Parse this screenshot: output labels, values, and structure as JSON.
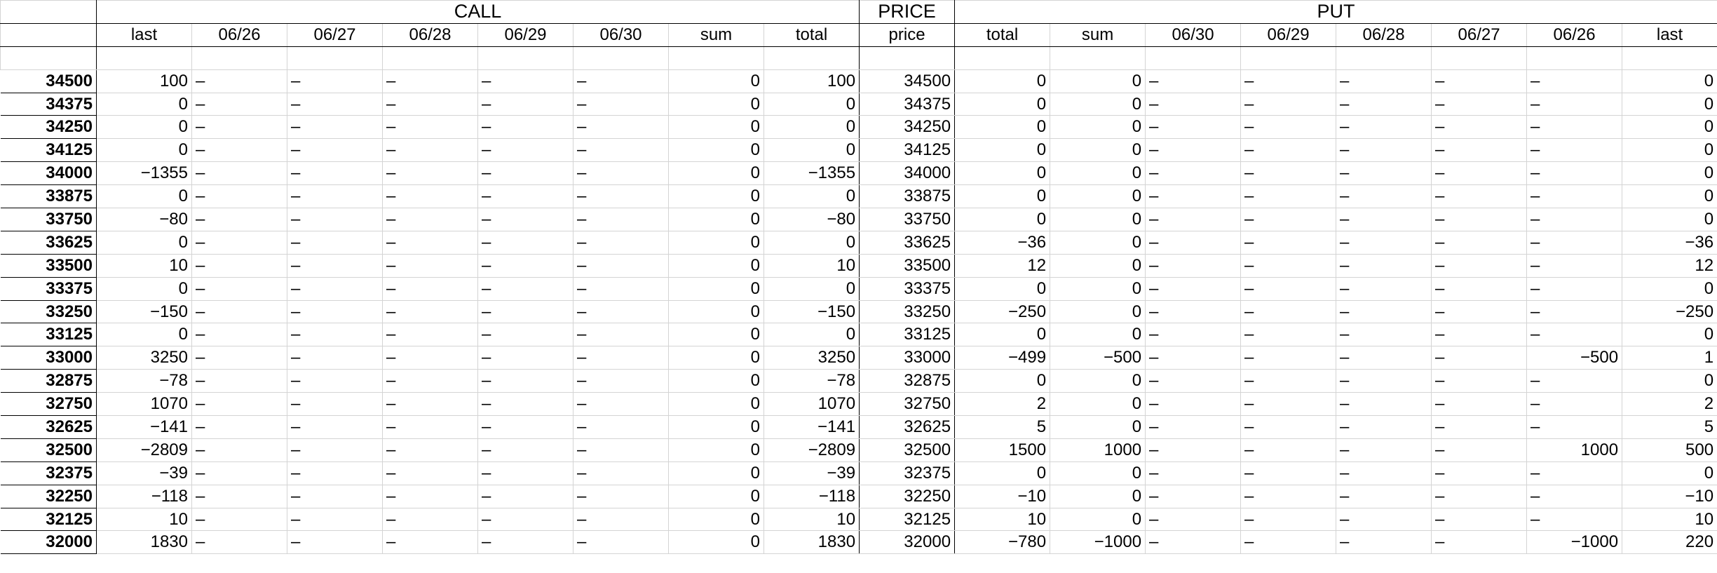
{
  "header": {
    "groups": {
      "call": "CALL",
      "price": "PRICE",
      "put": "PUT"
    },
    "columns": [
      "last",
      "06/26",
      "06/27",
      "06/28",
      "06/29",
      "06/30",
      "sum",
      "total",
      "price",
      "total",
      "sum",
      "06/30",
      "06/29",
      "06/28",
      "06/27",
      "06/26",
      "last"
    ]
  },
  "rows": [
    {
      "key": "34500",
      "call": [
        "100",
        "–",
        "–",
        "–",
        "–",
        "–",
        "0",
        "100"
      ],
      "price": "34500",
      "put": [
        "0",
        "0",
        "–",
        "–",
        "–",
        "–",
        "–",
        "0"
      ]
    },
    {
      "key": "34375",
      "call": [
        "0",
        "–",
        "–",
        "–",
        "–",
        "–",
        "0",
        "0"
      ],
      "price": "34375",
      "put": [
        "0",
        "0",
        "–",
        "–",
        "–",
        "–",
        "–",
        "0"
      ]
    },
    {
      "key": "34250",
      "call": [
        "0",
        "–",
        "–",
        "–",
        "–",
        "–",
        "0",
        "0"
      ],
      "price": "34250",
      "put": [
        "0",
        "0",
        "–",
        "–",
        "–",
        "–",
        "–",
        "0"
      ]
    },
    {
      "key": "34125",
      "call": [
        "0",
        "–",
        "–",
        "–",
        "–",
        "–",
        "0",
        "0"
      ],
      "price": "34125",
      "put": [
        "0",
        "0",
        "–",
        "–",
        "–",
        "–",
        "–",
        "0"
      ]
    },
    {
      "key": "34000",
      "call": [
        "−1355",
        "–",
        "–",
        "–",
        "–",
        "–",
        "0",
        "−1355"
      ],
      "price": "34000",
      "put": [
        "0",
        "0",
        "–",
        "–",
        "–",
        "–",
        "–",
        "0"
      ]
    },
    {
      "key": "33875",
      "call": [
        "0",
        "–",
        "–",
        "–",
        "–",
        "–",
        "0",
        "0"
      ],
      "price": "33875",
      "put": [
        "0",
        "0",
        "–",
        "–",
        "–",
        "–",
        "–",
        "0"
      ]
    },
    {
      "key": "33750",
      "call": [
        "−80",
        "–",
        "–",
        "–",
        "–",
        "–",
        "0",
        "−80"
      ],
      "price": "33750",
      "put": [
        "0",
        "0",
        "–",
        "–",
        "–",
        "–",
        "–",
        "0"
      ]
    },
    {
      "key": "33625",
      "call": [
        "0",
        "–",
        "–",
        "–",
        "–",
        "–",
        "0",
        "0"
      ],
      "price": "33625",
      "put": [
        "−36",
        "0",
        "–",
        "–",
        "–",
        "–",
        "–",
        "−36"
      ]
    },
    {
      "key": "33500",
      "call": [
        "10",
        "–",
        "–",
        "–",
        "–",
        "–",
        "0",
        "10"
      ],
      "price": "33500",
      "put": [
        "12",
        "0",
        "–",
        "–",
        "–",
        "–",
        "–",
        "12"
      ]
    },
    {
      "key": "33375",
      "call": [
        "0",
        "–",
        "–",
        "–",
        "–",
        "–",
        "0",
        "0"
      ],
      "price": "33375",
      "put": [
        "0",
        "0",
        "–",
        "–",
        "–",
        "–",
        "–",
        "0"
      ]
    },
    {
      "key": "33250",
      "call": [
        "−150",
        "–",
        "–",
        "–",
        "–",
        "–",
        "0",
        "−150"
      ],
      "price": "33250",
      "put": [
        "−250",
        "0",
        "–",
        "–",
        "–",
        "–",
        "–",
        "−250"
      ]
    },
    {
      "key": "33125",
      "call": [
        "0",
        "–",
        "–",
        "–",
        "–",
        "–",
        "0",
        "0"
      ],
      "price": "33125",
      "put": [
        "0",
        "0",
        "–",
        "–",
        "–",
        "–",
        "–",
        "0"
      ]
    },
    {
      "key": "33000",
      "call": [
        "3250",
        "–",
        "–",
        "–",
        "–",
        "–",
        "0",
        "3250"
      ],
      "price": "33000",
      "put": [
        "−499",
        "−500",
        "–",
        "–",
        "–",
        "–",
        "−500",
        "1"
      ]
    },
    {
      "key": "32875",
      "call": [
        "−78",
        "–",
        "–",
        "–",
        "–",
        "–",
        "0",
        "−78"
      ],
      "price": "32875",
      "put": [
        "0",
        "0",
        "–",
        "–",
        "–",
        "–",
        "–",
        "0"
      ]
    },
    {
      "key": "32750",
      "call": [
        "1070",
        "–",
        "–",
        "–",
        "–",
        "–",
        "0",
        "1070"
      ],
      "price": "32750",
      "put": [
        "2",
        "0",
        "–",
        "–",
        "–",
        "–",
        "–",
        "2"
      ]
    },
    {
      "key": "32625",
      "call": [
        "−141",
        "–",
        "–",
        "–",
        "–",
        "–",
        "0",
        "−141"
      ],
      "price": "32625",
      "put": [
        "5",
        "0",
        "–",
        "–",
        "–",
        "–",
        "–",
        "5"
      ]
    },
    {
      "key": "32500",
      "call": [
        "−2809",
        "–",
        "–",
        "–",
        "–",
        "–",
        "0",
        "−2809"
      ],
      "price": "32500",
      "put": [
        "1500",
        "1000",
        "–",
        "–",
        "–",
        "–",
        "1000",
        "500"
      ]
    },
    {
      "key": "32375",
      "call": [
        "−39",
        "–",
        "–",
        "–",
        "–",
        "–",
        "0",
        "−39"
      ],
      "price": "32375",
      "put": [
        "0",
        "0",
        "–",
        "–",
        "–",
        "–",
        "–",
        "0"
      ]
    },
    {
      "key": "32250",
      "call": [
        "−118",
        "–",
        "–",
        "–",
        "–",
        "–",
        "0",
        "−118"
      ],
      "price": "32250",
      "put": [
        "−10",
        "0",
        "–",
        "–",
        "–",
        "–",
        "–",
        "−10"
      ]
    },
    {
      "key": "32125",
      "call": [
        "10",
        "–",
        "–",
        "–",
        "–",
        "–",
        "0",
        "10"
      ],
      "price": "32125",
      "put": [
        "10",
        "0",
        "–",
        "–",
        "–",
        "–",
        "–",
        "10"
      ]
    },
    {
      "key": "32000",
      "call": [
        "1830",
        "–",
        "–",
        "–",
        "–",
        "–",
        "0",
        "1830"
      ],
      "price": "32000",
      "put": [
        "−780",
        "−1000",
        "–",
        "–",
        "–",
        "–",
        "−1000",
        "220"
      ]
    }
  ]
}
